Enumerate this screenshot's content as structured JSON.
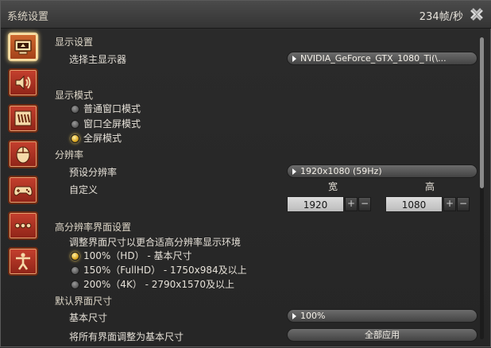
{
  "window": {
    "title": "系统设置",
    "fps": "234帧/秒"
  },
  "sidebar": {
    "items": [
      {
        "icon": "monitor-icon",
        "active": true
      },
      {
        "icon": "speaker-icon",
        "active": false
      },
      {
        "icon": "window-icon",
        "active": false
      },
      {
        "icon": "mouse-icon",
        "active": false
      },
      {
        "icon": "gamepad-icon",
        "active": false
      },
      {
        "icon": "more-icon",
        "active": false
      },
      {
        "icon": "accessibility-icon",
        "active": false
      }
    ]
  },
  "display": {
    "section_title": "显示设置",
    "main_display_label": "选择主显示器",
    "main_display_value": "NVIDIA_GeForce_GTX_1080_Ti(\\..."
  },
  "display_mode": {
    "section_title": "显示模式",
    "options": [
      "普通窗口模式",
      "窗口全屏模式",
      "全屏模式"
    ],
    "selected_index": 2
  },
  "resolution": {
    "section_title": "分辨率",
    "preset_label": "预设分辨率",
    "preset_value": "1920x1080 (59Hz)",
    "custom_label": "自定义",
    "width_label": "宽",
    "height_label": "高",
    "width_value": "1920",
    "height_value": "1080",
    "plus": "+",
    "minus": "−"
  },
  "hires_ui": {
    "section_title": "高分辨率界面设置",
    "description": "调整界面尺寸以更合适高分辨率显示环境",
    "options": [
      "100%（HD） - 基本尺寸",
      "150%（FullHD） - 1750x984及以上",
      "200%（4K） - 2790x1570及以上"
    ],
    "selected_index": 0
  },
  "default_ui": {
    "section_title": "默认界面尺寸",
    "base_size_label": "基本尺寸",
    "base_size_value": "100%",
    "apply_all_label": "将所有界面调整为基本尺寸",
    "apply_all_button": "全部应用"
  }
}
